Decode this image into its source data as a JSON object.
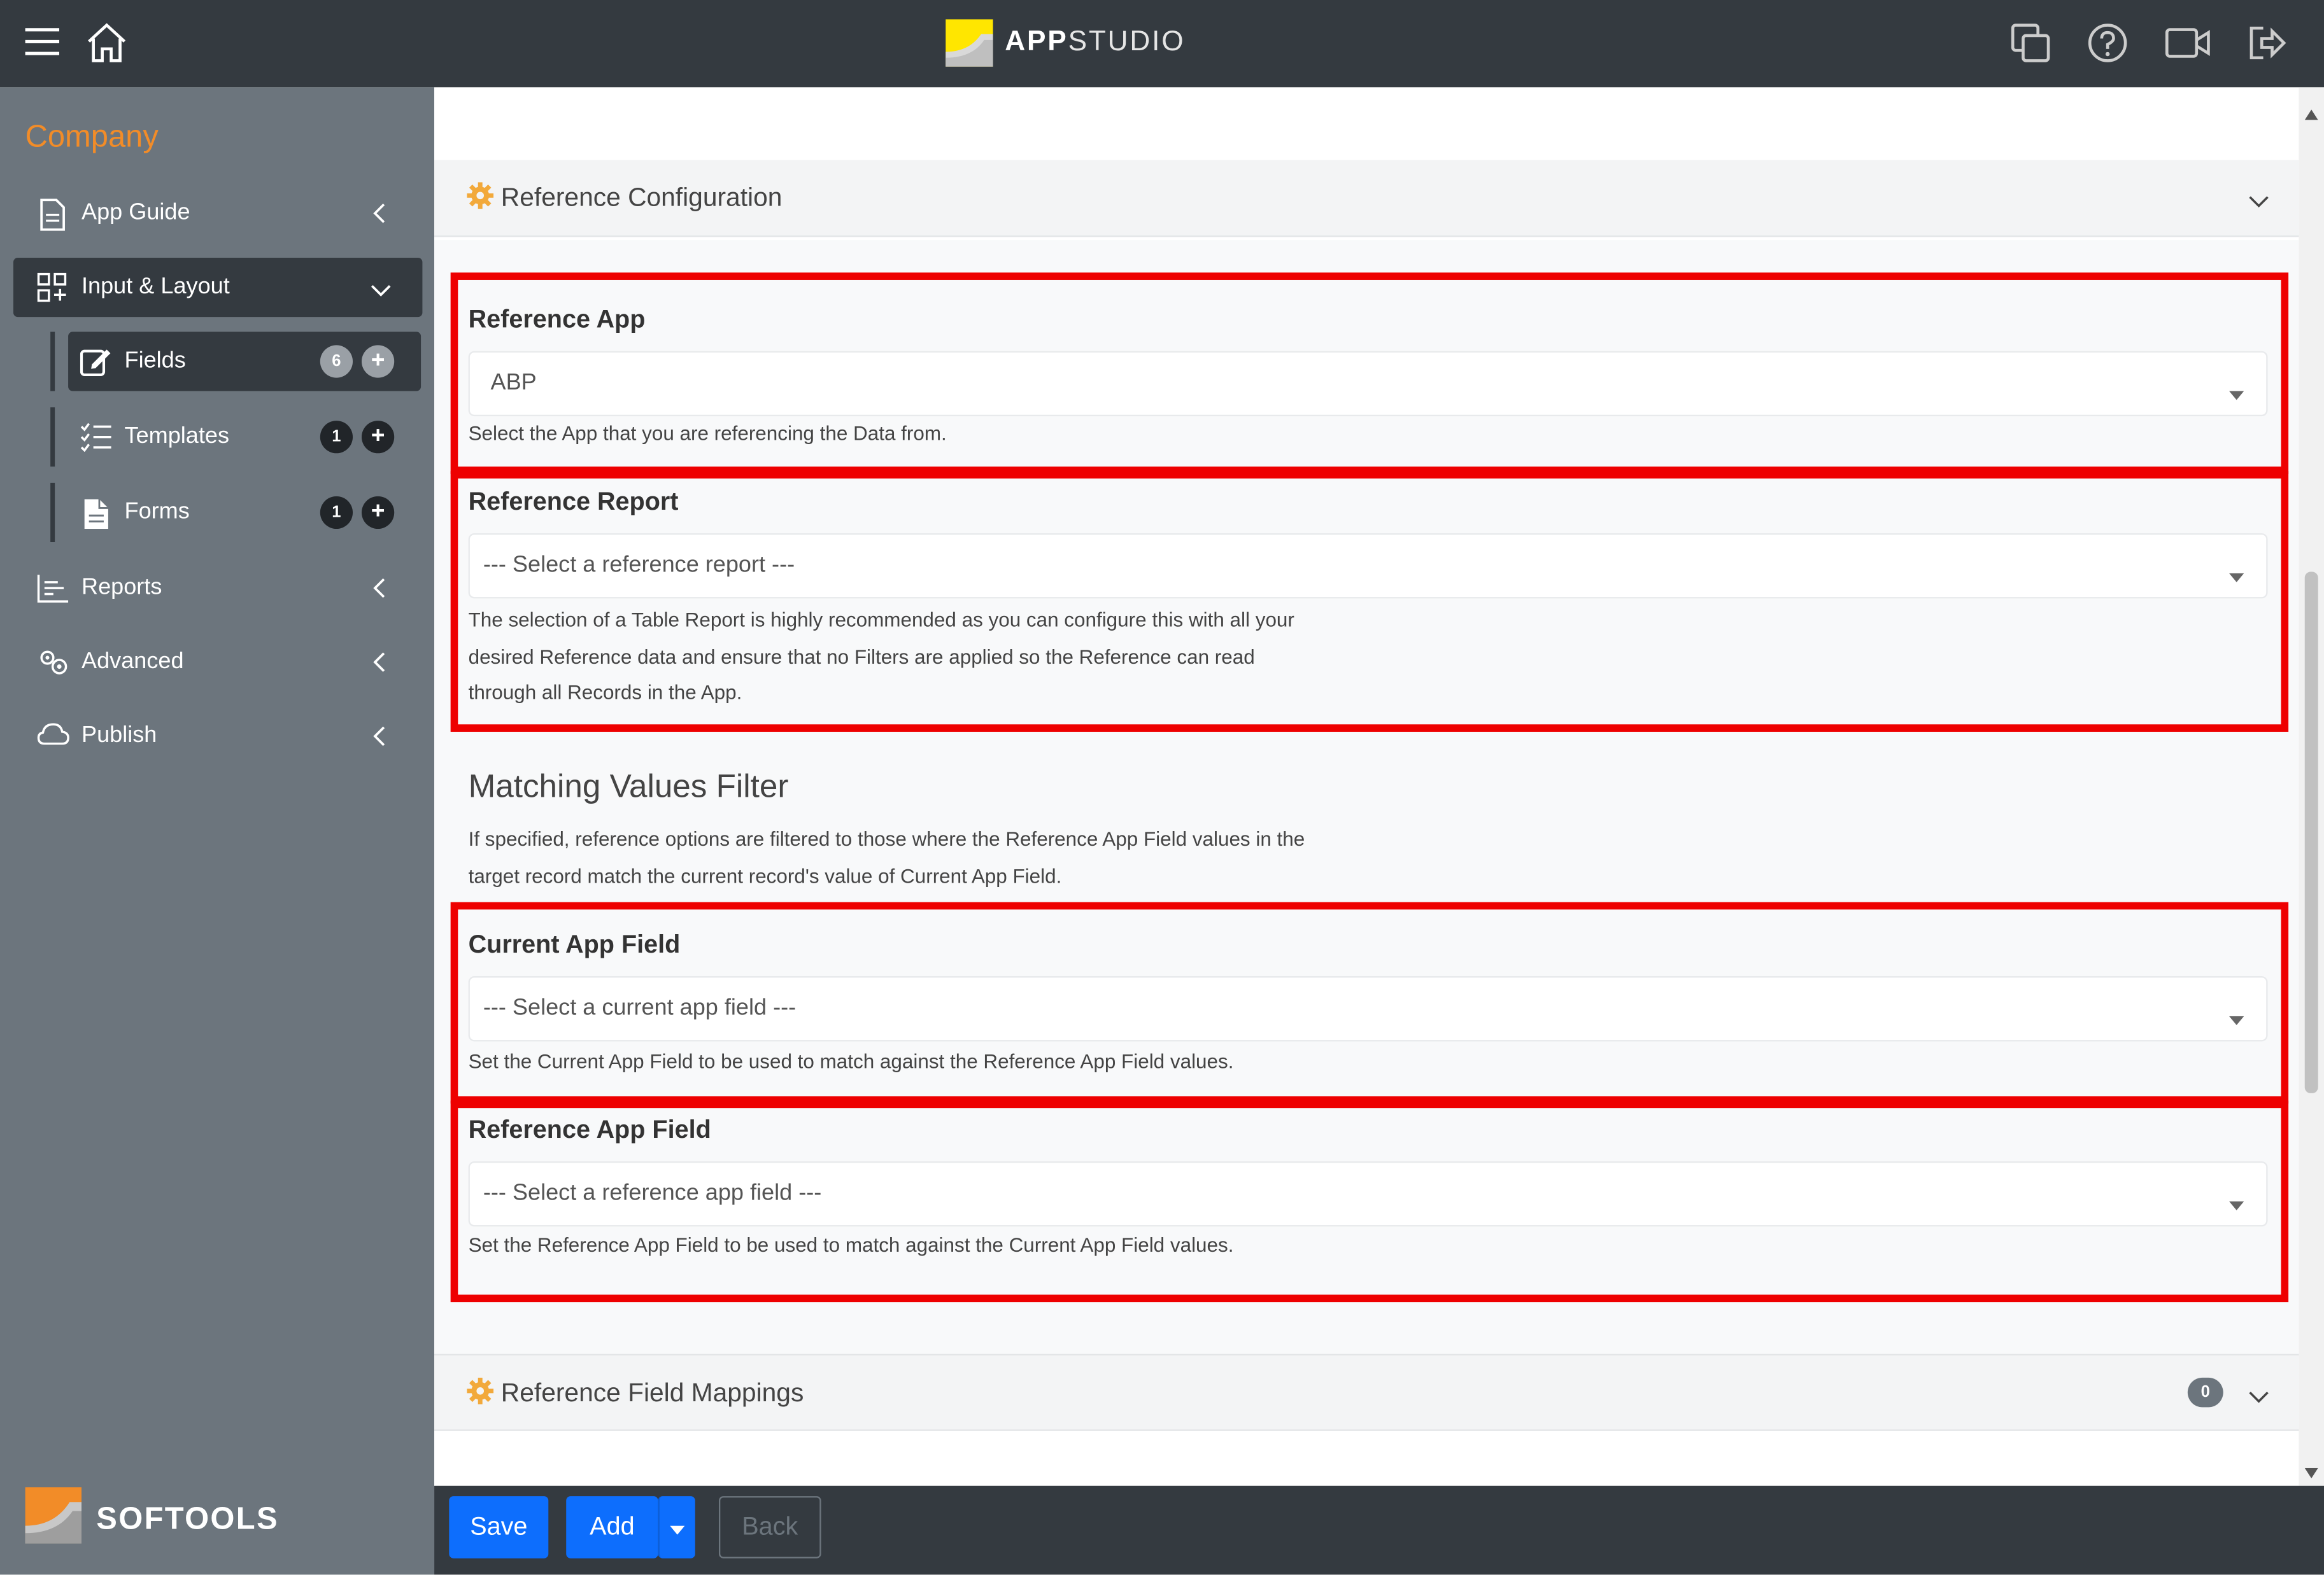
{
  "app": {
    "brand_bold": "APP",
    "brand_light": "STUDIO",
    "company": "Company",
    "vendor": "SOFTOOLS"
  },
  "colors": {
    "topbar": "#343a40",
    "sidebar": "#6c757d",
    "accent_orange": "#f28c28",
    "primary": "#0d6efd",
    "highlight": "#ee0000"
  },
  "topbar": {
    "icons": [
      "menu-icon",
      "home-icon",
      "copy-icon",
      "help-icon",
      "video-icon",
      "logout-icon"
    ]
  },
  "sidebar": {
    "items": [
      {
        "label": "App Guide",
        "icon": "document-icon"
      },
      {
        "label": "Input & Layout",
        "icon": "layout-icon"
      },
      {
        "label": "Reports",
        "icon": "chart-icon"
      },
      {
        "label": "Advanced",
        "icon": "gears-icon"
      },
      {
        "label": "Publish",
        "icon": "cloud-icon"
      }
    ],
    "subitems": [
      {
        "label": "Fields",
        "count": "6",
        "plus": "+"
      },
      {
        "label": "Templates",
        "count": "1",
        "plus": "+"
      },
      {
        "label": "Forms",
        "count": "1",
        "plus": "+"
      }
    ]
  },
  "main": {
    "panel1_title": "Reference Configuration",
    "reference_app": {
      "label": "Reference App",
      "value": "ABP",
      "help": "Select the App that you are referencing the Data from."
    },
    "reference_report": {
      "label": "Reference Report",
      "value": "--- Select a reference report ---",
      "help": "The selection of a Table Report is highly recommended as you can configure this with all your desired Reference data and ensure that no Filters are applied so the Reference can read through all Records in the App."
    },
    "matching": {
      "title": "Matching Values Filter",
      "help": "If specified, reference options are filtered to those where the Reference App Field values in the target record match the current record's value of Current App Field."
    },
    "current_app_field": {
      "label": "Current App Field",
      "value": "--- Select a current app field ---",
      "help": "Set the Current App Field to be used to match against the Reference App Field values."
    },
    "reference_app_field": {
      "label": "Reference App Field",
      "value": "--- Select a reference app field ---",
      "help": "Set the Reference App Field to be used to match against the Current App Field values."
    },
    "panel2_title": "Reference Field Mappings",
    "panel2_count": "0"
  },
  "footer": {
    "save": "Save",
    "add": "Add",
    "back": "Back"
  }
}
